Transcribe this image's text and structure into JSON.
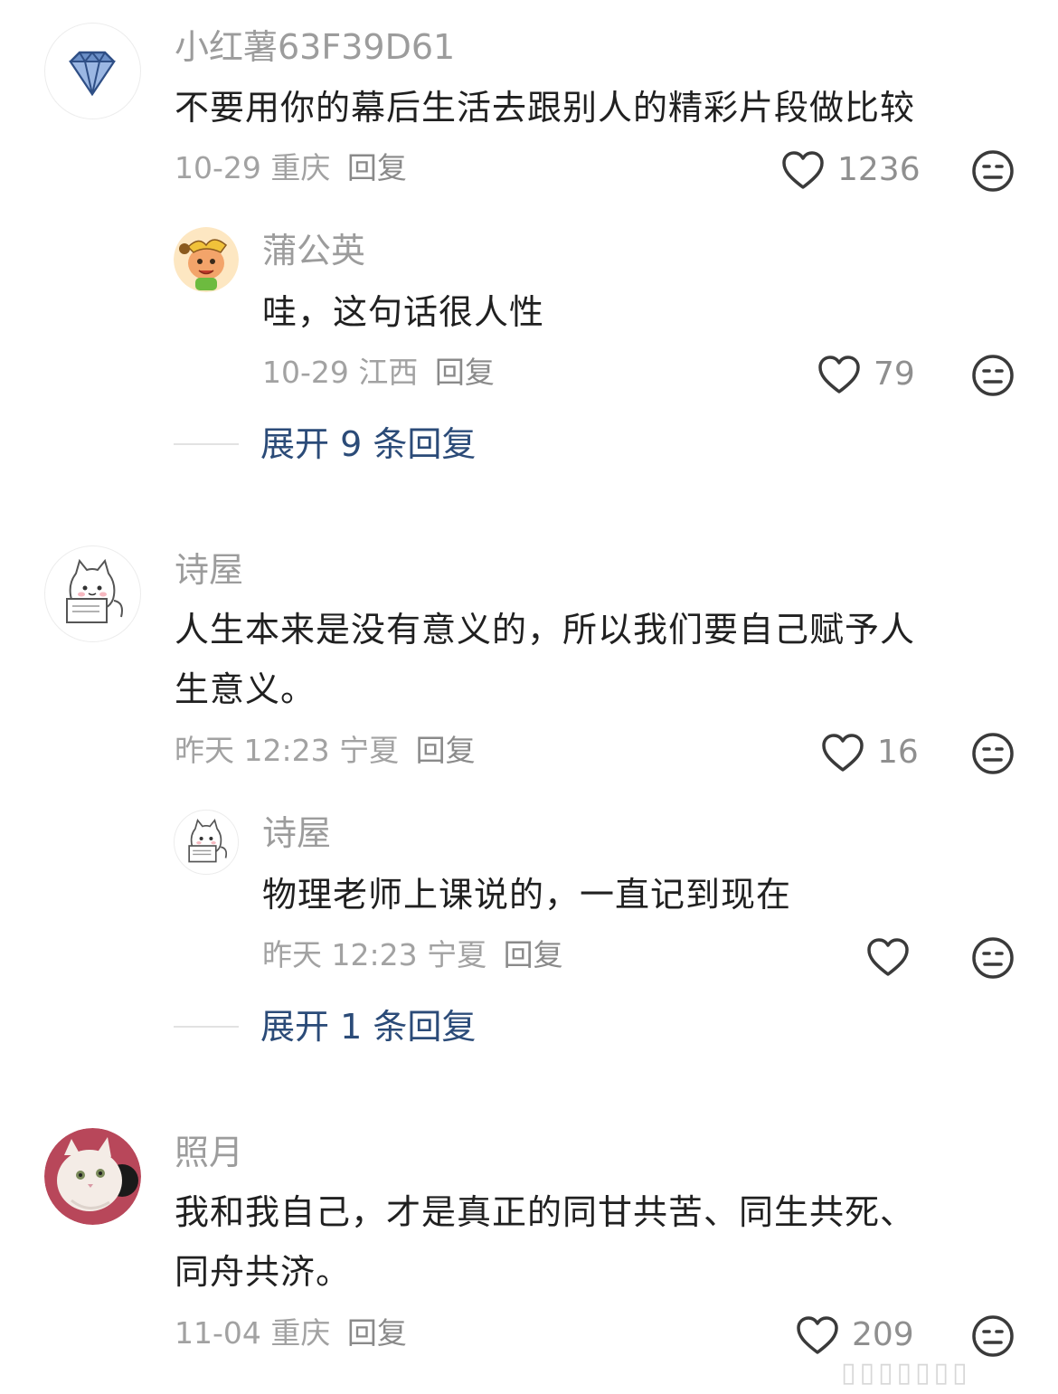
{
  "comments": [
    {
      "username": "小红薯63F39D61",
      "avatar": "diamond-icon",
      "text": "不要用你的幕后生活去跟别人的精彩片段做比较",
      "date": "10-29",
      "location": "重庆",
      "reply_label": "回复",
      "likes": "1236",
      "reply": {
        "username": "蒲公英",
        "avatar": "cartoon-girl-avatar",
        "text": "哇，这句话很人性",
        "date": "10-29",
        "location": "江西",
        "reply_label": "回复",
        "likes": "79"
      },
      "expand_label": "展开 9 条回复"
    },
    {
      "username": "诗屋",
      "avatar": "cat-reading-avatar",
      "text_line1": "人生本来是没有意义的，所以我们要自己赋予人",
      "text_line2": "生意义。",
      "date": "昨天 12:23",
      "location": "宁夏",
      "reply_label": "回复",
      "likes": "16",
      "reply": {
        "username": "诗屋",
        "avatar": "cat-reading-avatar",
        "text": "物理老师上课说的，一直记到现在",
        "date": "昨天 12:23",
        "location": "宁夏",
        "reply_label": "回复",
        "likes": ""
      },
      "expand_label": "展开 1 条回复"
    },
    {
      "username": "照月",
      "avatar": "white-cat-photo-avatar",
      "text_line1": "我和我自己，才是真正的同甘共苦、同生共死、",
      "text_line2": "同舟共济。",
      "date": "11-04",
      "location": "重庆",
      "reply_label": "回复",
      "likes": "209"
    }
  ],
  "colors": {
    "accent_link": "#2b4b78",
    "muted_text": "#9c9c9c",
    "body_text": "#202020"
  },
  "watermark": "▯▯▯▯▯▯▯"
}
